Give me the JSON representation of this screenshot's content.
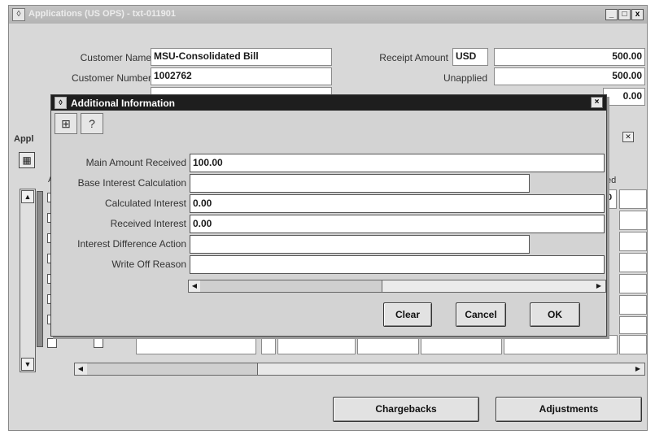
{
  "window": {
    "title": "Applications (US OPS) - txt-011901",
    "close_symbols": [
      "_",
      "□",
      "x"
    ]
  },
  "header": {
    "customer_name_label": "Customer Name",
    "customer_name": "MSU-Consolidated Bill",
    "customer_number_label": "Customer Number",
    "customer_number": "1002762",
    "receipt_amount_label": "Receipt Amount",
    "currency": "USD",
    "receipt_amount": "500.00",
    "unapplied_label": "Unapplied",
    "unapplied_amount": "500.00",
    "third_amount": "0.00"
  },
  "applications": {
    "section_label": "Appl",
    "column_partial_left": "A",
    "column_partial_right": "ed",
    "first_row_partial_value": "0",
    "rows": 8
  },
  "buttons": {
    "chargebacks": "Chargebacks",
    "adjustments": "Adjustments"
  },
  "dialog": {
    "title": "Additional Information",
    "fields": [
      {
        "label": "Main Amount Received",
        "value": "100.00"
      },
      {
        "label": "Base Interest Calculation",
        "value": ""
      },
      {
        "label": "Calculated Interest",
        "value": "0.00"
      },
      {
        "label": "Received Interest",
        "value": "0.00"
      },
      {
        "label": "Interest Difference Action",
        "value": ""
      },
      {
        "label": "Write Off Reason",
        "value": ""
      }
    ],
    "clear": "Clear",
    "cancel": "Cancel",
    "ok": "OK"
  }
}
